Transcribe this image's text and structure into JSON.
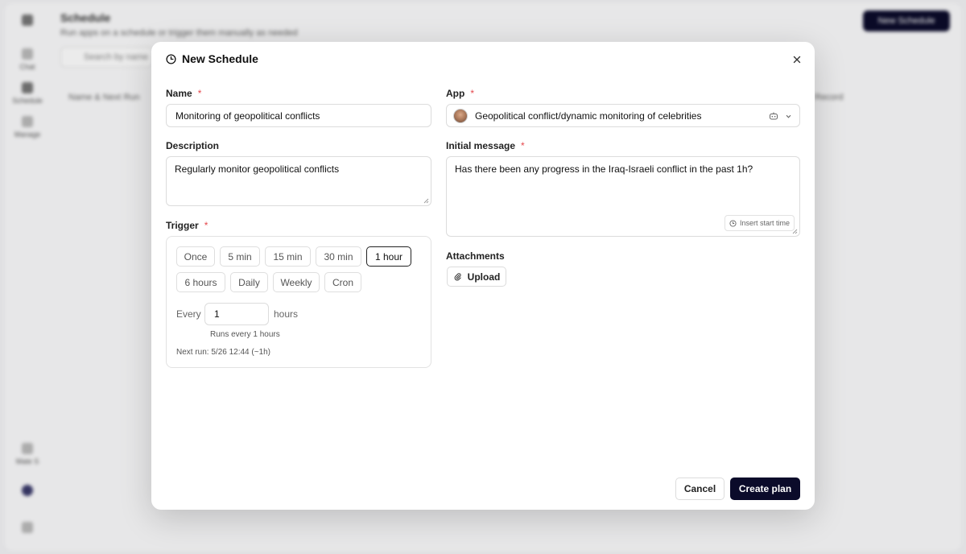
{
  "background": {
    "title": "Schedule",
    "subtitle": "Run apps on a schedule or trigger them manually as needed",
    "new_button": "New Schedule",
    "search_placeholder": "Search by name",
    "col_name": "Name & Next Run",
    "col_record": "Record",
    "sidebar": [
      "Chat",
      "Schedule",
      "Manage",
      "Mate S",
      ""
    ]
  },
  "modal": {
    "title": "New Schedule",
    "close_icon": "close-icon",
    "title_icon": "clock-icon"
  },
  "form": {
    "name_label": "Name",
    "name_value": "Monitoring of geopolitical conflicts",
    "description_label": "Description",
    "description_value": "Regularly monitor geopolitical conflicts",
    "trigger_label": "Trigger",
    "app_label": "App",
    "app_value": "Geopolitical conflict/dynamic monitoring of celebrities",
    "initial_message_label": "Initial message",
    "initial_message_value": "Has there been any progress in the Iraq-Israeli conflict in the past 1h?",
    "insert_start_time": "Insert start time",
    "attachments_label": "Attachments",
    "upload_label": "Upload",
    "required_mark": "*"
  },
  "trigger": {
    "options": [
      "Once",
      "5 min",
      "15 min",
      "30 min",
      "1 hour",
      "6 hours",
      "Daily",
      "Weekly",
      "Cron"
    ],
    "selected": "1 hour",
    "every_label": "Every",
    "every_value": "1",
    "unit_label": "hours",
    "runs_text": "Runs every 1 hours",
    "next_run": "Next run: 5/26 12:44 (~1h)"
  },
  "footer": {
    "cancel": "Cancel",
    "create": "Create plan"
  },
  "colors": {
    "primary": "#0b0b2a",
    "required": "#e5484d",
    "border": "#dcdcdc"
  }
}
